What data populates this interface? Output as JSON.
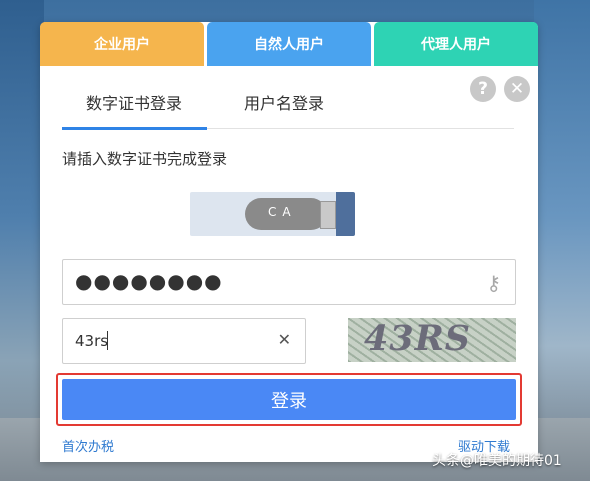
{
  "user_tabs": [
    {
      "label": "企业用户",
      "color": "#f5b54d"
    },
    {
      "label": "自然人用户",
      "color": "#4aa3ef"
    },
    {
      "label": "代理人用户",
      "color": "#2ed3b4"
    }
  ],
  "login_tabs": {
    "cert_label": "数字证书登录",
    "username_label": "用户名登录",
    "active": "cert_label"
  },
  "icons": {
    "help": "?",
    "close": "✕",
    "key": "key-icon",
    "clear": "✕"
  },
  "hint": "请插入数字证书完成登录",
  "usb_key_text": "CA",
  "password": {
    "value": "●●●●●●●●"
  },
  "captcha": {
    "input_value": "43rs",
    "image_text": "43RS"
  },
  "login_button": "登录",
  "links": {
    "first_time": "首次办税",
    "driver_download": "驱动下载"
  },
  "watermark": "头条@唯美的期待01",
  "colors": {
    "accent": "#4a88f5",
    "highlight_border": "#e33a33",
    "link": "#2f7ad0"
  }
}
